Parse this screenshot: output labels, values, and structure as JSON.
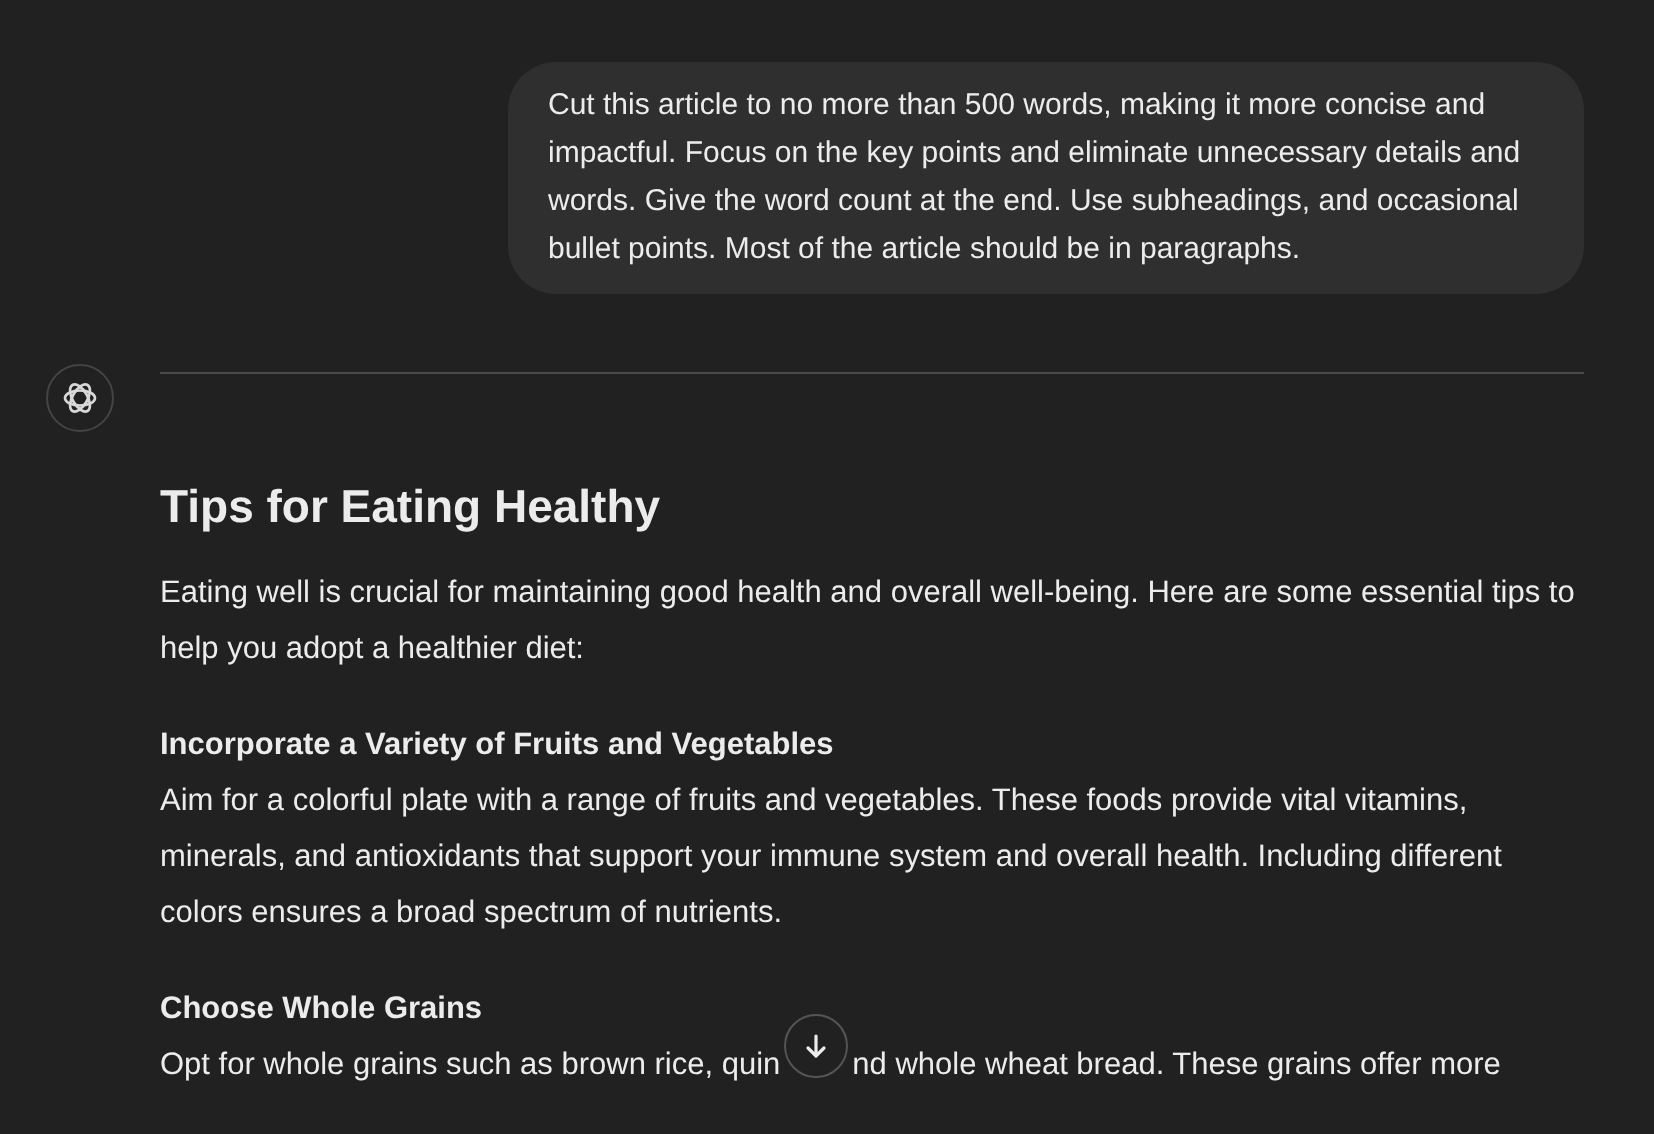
{
  "user_message": "Cut this article to no more than 500 words, making it more concise and impactful. Focus on the key points and eliminate unnecessary details and words. Give the word count at the end. Use subheadings, and occasional bullet points. Most of the article should be in paragraphs.",
  "response": {
    "title": "Tips for Eating Healthy",
    "blocks": [
      {
        "kind": "paragraph",
        "text": "Eating well is crucial for maintaining good health and overall well-being. Here are some essential tips to help you adopt a healthier diet:"
      },
      {
        "kind": "section",
        "heading": "Incorporate a Variety of Fruits and Vegetables",
        "text": "Aim for a colorful plate with a range of fruits and vegetables. These foods provide vital vitamins, minerals, and antioxidants that support your immune system and overall health. Including different colors ensures a broad spectrum of nutrients."
      },
      {
        "kind": "split",
        "heading": "Choose Whole Grains",
        "before": "Opt for whole grains such as brown rice, quin",
        "after": "nd whole wheat bread. These grains offer more"
      }
    ]
  }
}
